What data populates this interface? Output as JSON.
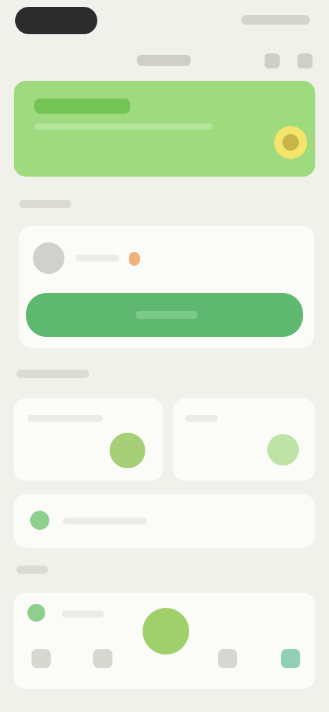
{
  "banner": {
    "accent_color": "#9fdb7e",
    "icon": "sun-icon"
  },
  "primary_button": {
    "color": "#5fb86f"
  },
  "bottom_nav": {
    "items": [
      {
        "icon": "home-icon"
      },
      {
        "icon": "grid-icon"
      },
      {
        "icon": "add-icon"
      },
      {
        "icon": "chart-icon"
      },
      {
        "icon": "profile-icon"
      }
    ]
  }
}
